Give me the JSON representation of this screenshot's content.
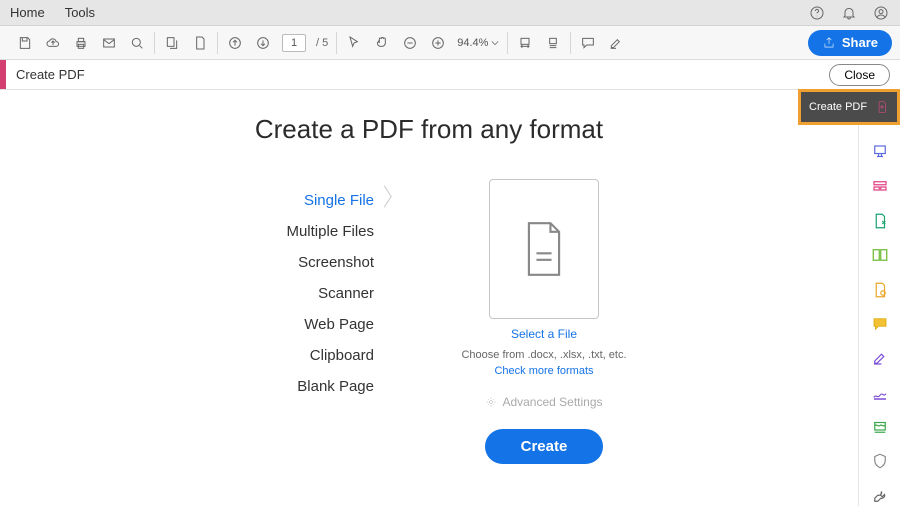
{
  "menubar": {
    "home": "Home",
    "tools": "Tools"
  },
  "toolbar": {
    "page_current": "1",
    "page_total": "/  5",
    "zoom": "94.4%",
    "share": "Share"
  },
  "context": {
    "title": "Create PDF",
    "close": "Close"
  },
  "callout": {
    "label": "Create PDF"
  },
  "heading": "Create a PDF from any format",
  "sources": {
    "single": "Single File",
    "multiple": "Multiple Files",
    "screenshot": "Screenshot",
    "scanner": "Scanner",
    "webpage": "Web Page",
    "clipboard": "Clipboard",
    "blank": "Blank Page"
  },
  "drop": {
    "select": "Select a File",
    "choose": "Choose from .docx, .xlsx, .txt, etc.",
    "check": "Check more formats",
    "advanced": "Advanced Settings",
    "create": "Create"
  }
}
